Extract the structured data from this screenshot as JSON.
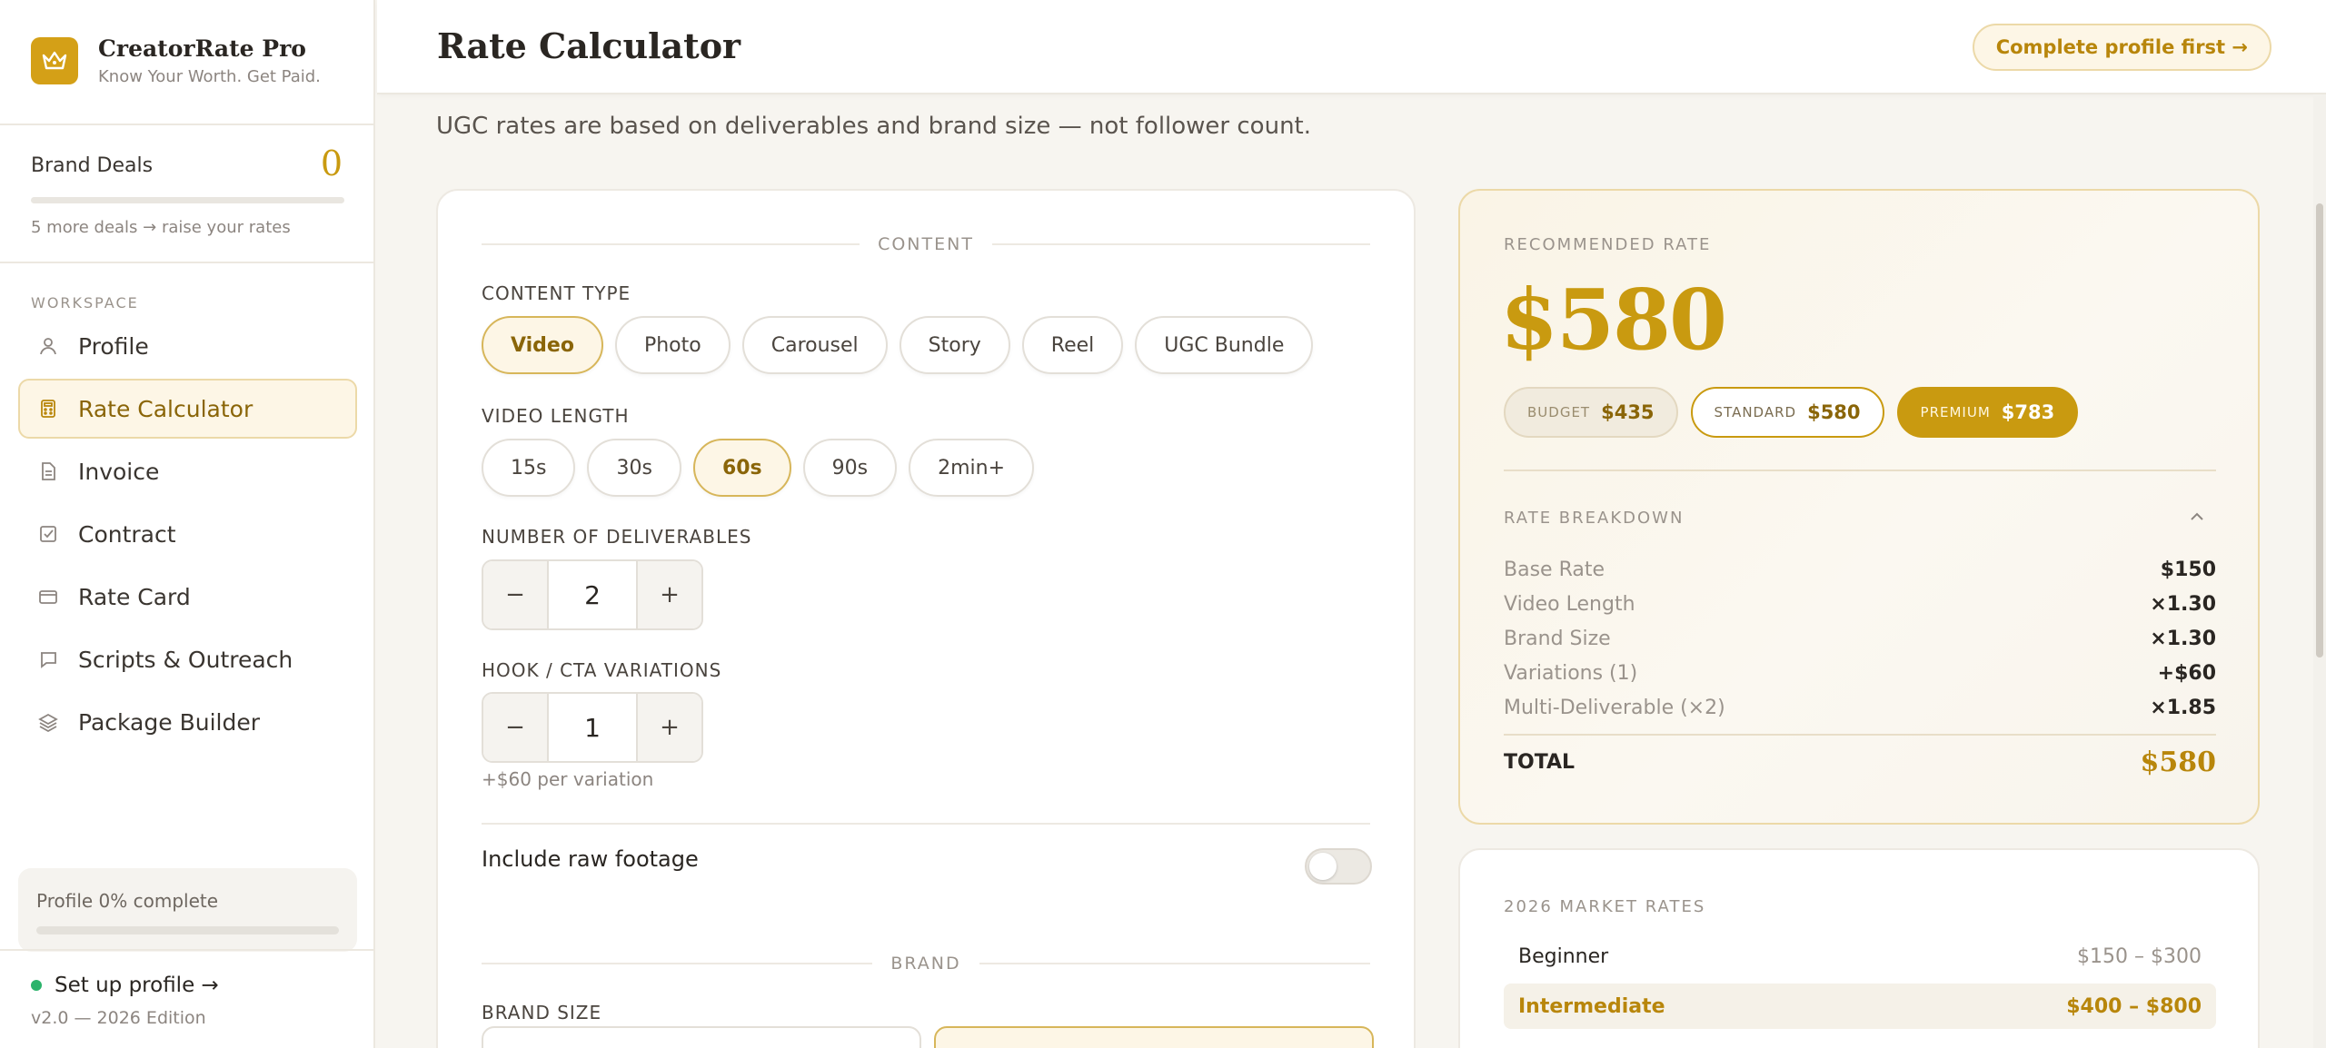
{
  "app": {
    "name": "CreatorRate Pro",
    "tagline": "Know Your Worth. Get Paid."
  },
  "deals": {
    "label": "Brand Deals",
    "count": "0",
    "hint": "5 more deals → raise your rates",
    "progress": 0
  },
  "sidebar": {
    "section": "WORKSPACE",
    "items": [
      {
        "label": "Profile",
        "icon": "user-icon"
      },
      {
        "label": "Rate Calculator",
        "icon": "calculator-icon",
        "active": true
      },
      {
        "label": "Invoice",
        "icon": "document-icon"
      },
      {
        "label": "Contract",
        "icon": "checkbox-icon"
      },
      {
        "label": "Rate Card",
        "icon": "card-icon"
      },
      {
        "label": "Scripts & Outreach",
        "icon": "chat-icon"
      },
      {
        "label": "Package Builder",
        "icon": "layers-icon"
      }
    ],
    "profile": {
      "label": "Profile 0% complete",
      "progress": 0
    },
    "setup": "Set up profile →",
    "version": "v2.0 — 2026 Edition"
  },
  "header": {
    "title": "Rate Calculator",
    "cta": "Complete profile first →"
  },
  "subtitle": "UGC rates are based on deliverables and brand size — not follower count.",
  "form": {
    "content_section": "CONTENT",
    "content_type": {
      "label": "CONTENT TYPE",
      "options": [
        "Video",
        "Photo",
        "Carousel",
        "Story",
        "Reel",
        "UGC Bundle"
      ],
      "selected": "Video"
    },
    "video_length": {
      "label": "VIDEO LENGTH",
      "options": [
        "15s",
        "30s",
        "60s",
        "90s",
        "2min+"
      ],
      "selected": "60s"
    },
    "deliverables": {
      "label": "NUMBER OF DELIVERABLES",
      "value": "2",
      "minus": "−",
      "plus": "+"
    },
    "variations": {
      "label": "HOOK / CTA VARIATIONS",
      "value": "1",
      "minus": "−",
      "plus": "+",
      "hint": "+$60 per variation"
    },
    "raw_footage": {
      "label": "Include raw footage",
      "on": false
    },
    "brand_section": "BRAND",
    "brand_size": {
      "label": "BRAND SIZE"
    }
  },
  "recommended": {
    "label": "RECOMMENDED RATE",
    "value": "$580",
    "tiers": [
      {
        "name": "BUDGET",
        "value": "$435"
      },
      {
        "name": "STANDARD",
        "value": "$580"
      },
      {
        "name": "PREMIUM",
        "value": "$783"
      }
    ],
    "breakdown_label": "RATE BREAKDOWN",
    "breakdown": [
      {
        "k": "Base Rate",
        "v": "$150"
      },
      {
        "k": "Video Length",
        "v": "×1.30"
      },
      {
        "k": "Brand Size",
        "v": "×1.30"
      },
      {
        "k": "Variations (1)",
        "v": "+$60"
      },
      {
        "k": "Multi-Deliverable (×2)",
        "v": "×1.85"
      }
    ],
    "total_label": "TOTAL",
    "total": "$580"
  },
  "market": {
    "label": "2026 MARKET RATES",
    "rows": [
      {
        "k": "Beginner",
        "v": "$150 – $300"
      },
      {
        "k": "Intermediate",
        "v": "$400 – $800",
        "highlight": true
      }
    ]
  },
  "colors": {
    "accent": "#c99a10",
    "accent_bg": "#fdf6e6",
    "status_dot": "#2bb36b"
  }
}
